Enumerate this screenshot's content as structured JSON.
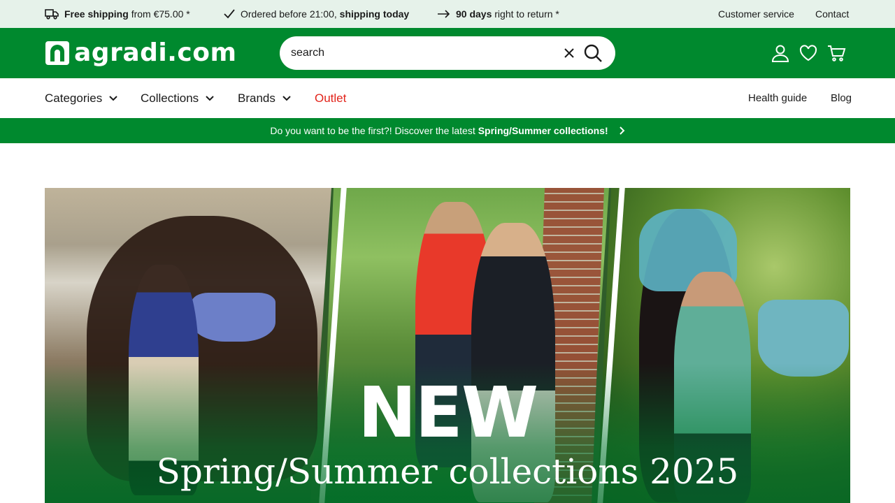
{
  "usp_bar": {
    "shipping": {
      "bold": "Free shipping",
      "rest": "from €75.00 *"
    },
    "ordered": {
      "rest": "Ordered before 21:00,",
      "bold": "shipping today"
    },
    "returns": {
      "bold": "90 days",
      "rest": "right to return *"
    },
    "links": {
      "customer_service": "Customer service",
      "contact": "Contact"
    }
  },
  "header": {
    "logo_text": "agradi.com",
    "search": {
      "placeholder": "search"
    },
    "icons": [
      "account-icon",
      "heart-icon",
      "cart-icon"
    ]
  },
  "nav": {
    "items": [
      {
        "label": "Categories"
      },
      {
        "label": "Collections"
      },
      {
        "label": "Brands"
      },
      {
        "label": "Outlet"
      }
    ],
    "right_links": {
      "health_guide": "Health guide",
      "blog": "Blog"
    }
  },
  "promo": {
    "text": "Do you want to be the first?! Discover the latest",
    "bold": "Spring/Summer collections!"
  },
  "hero": {
    "headline": "NEW",
    "subline": "Spring/Summer collections 2025"
  },
  "colors": {
    "brand_green": "#00892e",
    "usp_bg": "#e6f2ea",
    "outlet_red": "#e2231a"
  }
}
